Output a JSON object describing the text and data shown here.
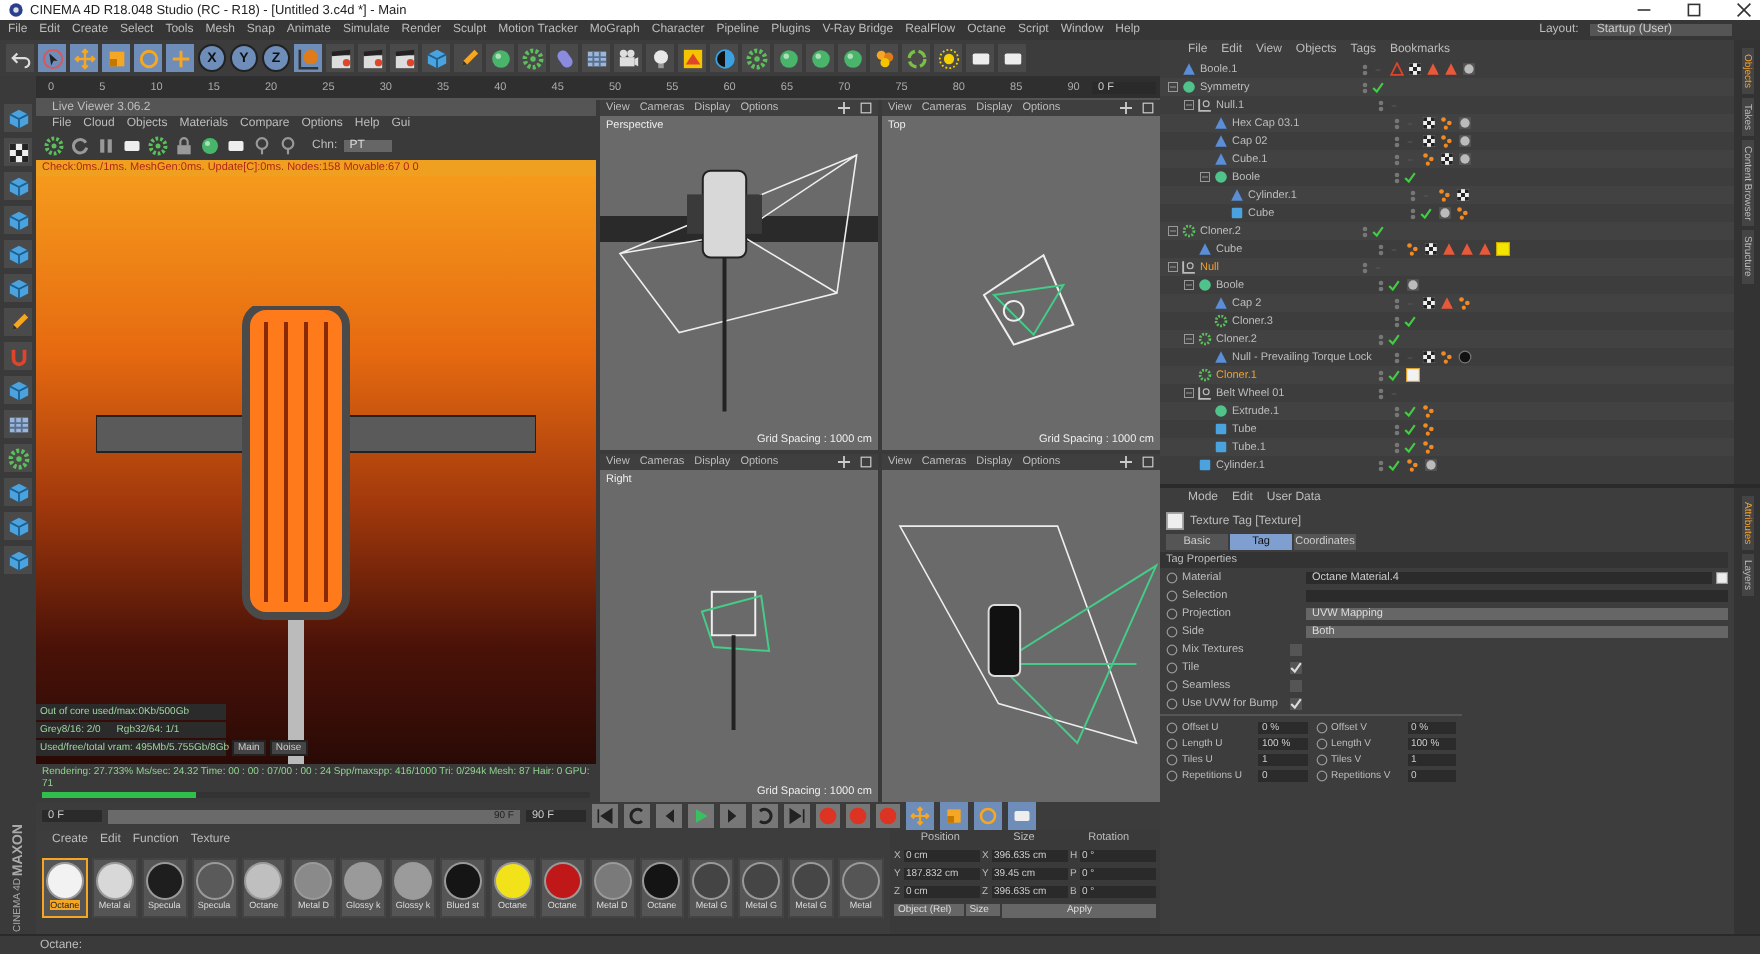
{
  "window": {
    "title": "CINEMA 4D R18.048 Studio (RC - R18) - [Untitled 3.c4d *] - Main"
  },
  "menu_bar": [
    "File",
    "Edit",
    "Create",
    "Select",
    "Tools",
    "Mesh",
    "Snap",
    "Animate",
    "Simulate",
    "Render",
    "Sculpt",
    "Motion Tracker",
    "MoGraph",
    "Character",
    "Pipeline",
    "Plugins",
    "V-Ray Bridge",
    "RealFlow",
    "Octane",
    "Script",
    "Window",
    "Help"
  ],
  "layout": {
    "label": "Layout:",
    "value": "Startup (User)"
  },
  "toolbar": {
    "axis_buttons": [
      "X",
      "Y",
      "Z"
    ]
  },
  "timeline_ruler": {
    "ticks": [
      "0",
      "5",
      "10",
      "15",
      "20",
      "25",
      "30",
      "35",
      "40",
      "45",
      "50",
      "55",
      "60",
      "65",
      "70",
      "75",
      "80",
      "85",
      "90"
    ],
    "frame_field": "0 F"
  },
  "live_viewer": {
    "title": "Live Viewer 3.06.2",
    "menu": [
      "File",
      "Cloud",
      "Objects",
      "Materials",
      "Compare",
      "Options",
      "Help",
      "Gui"
    ],
    "channel_label": "Chn:",
    "channel_value": "PT",
    "status_line": "Check:0ms./1ms. MeshGen:0ms. Update[C]:0ms. Nodes:158 Movable:67  0 0",
    "stats": [
      [
        "Out of core used/max:0Kb/500Gb"
      ],
      [
        "Grey8/16: 2/0",
        "Rgb32/64: 1/1"
      ],
      [
        "Used/free/total vram: 495Mb/5.755Gb/8Gb"
      ]
    ],
    "buttons": [
      "Main",
      "Noise"
    ],
    "render_status": "Rendering: 27.733%  Ms/sec: 24.32  Time: 00 : 00 : 07/00 : 00 : 24  Spp/maxspp: 416/1000  Tri: 0/294k  Mesh: 87  Hair: 0  GPU:  71",
    "level": 0.28
  },
  "viewports": [
    {
      "kind": "perspective",
      "label": "Perspective",
      "menu": [
        "View",
        "Cameras",
        "Display",
        "Options"
      ],
      "grid": "Grid Spacing : 1000 cm"
    },
    {
      "kind": "top",
      "label": "Top",
      "menu": [
        "View",
        "Cameras",
        "Display",
        "Options"
      ],
      "grid": "Grid Spacing : 1000 cm"
    },
    {
      "kind": "right",
      "label": "Right",
      "menu": [
        "View",
        "Cameras",
        "Display",
        "Options"
      ],
      "grid": "Grid Spacing : 1000 cm"
    },
    {
      "kind": "front",
      "menu": [
        "View",
        "Cameras",
        "Display",
        "Options"
      ]
    }
  ],
  "transport": {
    "start_field": "0 F",
    "scrubber_end": "90 F",
    "end_field": "90 F"
  },
  "material_manager": {
    "menu": [
      "Create",
      "Edit",
      "Function",
      "Texture"
    ],
    "materials": [
      {
        "name": "Octane",
        "color": "#f2f2f2",
        "selected": true
      },
      {
        "name": "Metal ai",
        "color": "#d8d8d8",
        "selected": false
      },
      {
        "name": "Specula",
        "color": "#1e1e1e",
        "selected": false
      },
      {
        "name": "Specula",
        "color": "#5a5a5a",
        "selected": false
      },
      {
        "name": "Octane",
        "color": "#bfbfbf",
        "selected": false
      },
      {
        "name": "Metal D",
        "color": "#8a8a8a",
        "selected": false
      },
      {
        "name": "Glossy k",
        "color": "#9a9a9a",
        "selected": false
      },
      {
        "name": "Glossy k",
        "color": "#9b9b9b",
        "selected": false
      },
      {
        "name": "Blued st",
        "color": "#151515",
        "selected": false
      },
      {
        "name": "Octane",
        "color": "#f2e21a",
        "selected": false
      },
      {
        "name": "Octane",
        "color": "#c01818",
        "selected": false
      },
      {
        "name": "Metal D",
        "color": "#7a7a7a",
        "selected": false
      },
      {
        "name": "Octane",
        "color": "#141414",
        "selected": false
      },
      {
        "name": "Metal G",
        "color": "#444444",
        "selected": false
      },
      {
        "name": "Metal G",
        "color": "#454545",
        "selected": false
      },
      {
        "name": "Metal G",
        "color": "#464646",
        "selected": false
      },
      {
        "name": "Metal",
        "color": "#555555",
        "selected": false
      }
    ]
  },
  "coordinates": {
    "headers": [
      "Position",
      "Size",
      "Rotation"
    ],
    "rows": [
      {
        "cells": [
          {
            "axis": "X",
            "value": "0 cm"
          },
          {
            "axis": "X",
            "value": "396.635 cm"
          },
          {
            "axis": "H",
            "value": "0 °"
          }
        ]
      },
      {
        "cells": [
          {
            "axis": "Y",
            "value": "187.832 cm"
          },
          {
            "axis": "Y",
            "value": "39.45 cm"
          },
          {
            "axis": "P",
            "value": "0 °"
          }
        ]
      },
      {
        "cells": [
          {
            "axis": "Z",
            "value": "0 cm"
          },
          {
            "axis": "Z",
            "value": "396.635 cm"
          },
          {
            "axis": "B",
            "value": "0 °"
          }
        ]
      }
    ],
    "mode": "Object (Rel)",
    "size_mode": "Size",
    "apply": "Apply"
  },
  "object_manager": {
    "menu": [
      "File",
      "Edit",
      "View",
      "Objects",
      "Tags",
      "Bookmarks"
    ],
    "items": [
      {
        "name": "Boole.1",
        "kind": "mesh",
        "selected": false,
        "checked": false,
        "tags": [
          {
            "kind": "warning"
          },
          {
            "kind": "checker"
          },
          {
            "kind": "cone"
          },
          {
            "kind": "cone"
          },
          {
            "kind": "material"
          }
        ]
      },
      {
        "name": "Symmetry",
        "kind": "generator",
        "selected": false,
        "checked": true,
        "children": [
          {
            "name": "Null.1",
            "kind": "null",
            "selected": false,
            "checked": false,
            "children": [
              {
                "name": "Hex Cap 03.1",
                "kind": "mesh",
                "selected": false,
                "checked": false,
                "tags": [
                  {
                    "kind": "checker"
                  },
                  {
                    "kind": "dots"
                  },
                  {
                    "kind": "material"
                  }
                ]
              },
              {
                "name": "Cap 02",
                "kind": "mesh",
                "selected": false,
                "checked": false,
                "tags": [
                  {
                    "kind": "checker"
                  },
                  {
                    "kind": "dots"
                  },
                  {
                    "kind": "material"
                  }
                ]
              },
              {
                "name": "Cube.1",
                "kind": "mesh",
                "selected": false,
                "checked": false,
                "tags": [
                  {
                    "kind": "dots"
                  },
                  {
                    "kind": "checker"
                  },
                  {
                    "kind": "material"
                  }
                ]
              },
              {
                "name": "Boole",
                "kind": "generator",
                "selected": false,
                "checked": true,
                "children": [
                  {
                    "name": "Cylinder.1",
                    "kind": "mesh",
                    "selected": false,
                    "checked": false,
                    "tags": [
                      {
                        "kind": "dots"
                      },
                      {
                        "kind": "checker"
                      }
                    ]
                  },
                  {
                    "name": "Cube",
                    "kind": "primitive",
                    "selected": false,
                    "checked": true,
                    "tags": [
                      {
                        "kind": "material"
                      },
                      {
                        "kind": "dots"
                      }
                    ]
                  }
                ]
              }
            ]
          }
        ]
      },
      {
        "name": "Cloner.2",
        "kind": "cloner",
        "selected": false,
        "checked": true,
        "children": [
          {
            "name": "Cube",
            "kind": "mesh",
            "selected": false,
            "checked": false,
            "tags": [
              {
                "kind": "dots"
              },
              {
                "kind": "checker"
              },
              {
                "kind": "cone"
              },
              {
                "kind": "cone"
              },
              {
                "kind": "cone"
              },
              {
                "kind": "yellow"
              }
            ]
          }
        ]
      },
      {
        "name": "Null",
        "kind": "null",
        "selected": true,
        "checked": false,
        "children": [
          {
            "name": "Boole",
            "kind": "generator",
            "selected": false,
            "checked": true,
            "tags": [
              {
                "kind": "material"
              }
            ],
            "children": [
              {
                "name": "Cap 2",
                "kind": "mesh",
                "selected": false,
                "checked": false,
                "tags": [
                  {
                    "kind": "checker"
                  },
                  {
                    "kind": "cone"
                  },
                  {
                    "kind": "dots"
                  }
                ]
              },
              {
                "name": "Cloner.3",
                "kind": "cloner",
                "selected": false,
                "checked": true
              }
            ]
          },
          {
            "name": "Cloner.2",
            "kind": "cloner",
            "selected": false,
            "checked": true,
            "children": [
              {
                "name": "Null - Prevailing Torque Lock",
                "kind": "mesh",
                "selected": false,
                "checked": false,
                "tags": [
                  {
                    "kind": "checker"
                  },
                  {
                    "kind": "dots"
                  },
                  {
                    "kind": "black"
                  }
                ]
              }
            ]
          },
          {
            "name": "Cloner.1",
            "kind": "cloner",
            "selected": true,
            "checked": true,
            "tags": [
              {
                "kind": "white"
              }
            ]
          },
          {
            "name": "Belt Wheel 01",
            "kind": "null",
            "selected": false,
            "checked": false,
            "children": [
              {
                "name": "Extrude.1",
                "kind": "generator",
                "selected": false,
                "checked": true,
                "tags": [
                  {
                    "kind": "dots"
                  }
                ]
              },
              {
                "name": "Tube",
                "kind": "primitive",
                "selected": false,
                "checked": true,
                "tags": [
                  {
                    "kind": "dots"
                  }
                ]
              },
              {
                "name": "Tube.1",
                "kind": "primitive",
                "selected": false,
                "checked": true,
                "tags": [
                  {
                    "kind": "dots"
                  }
                ]
              }
            ]
          },
          {
            "name": "Cylinder.1",
            "kind": "primitive",
            "selected": false,
            "checked": true,
            "tags": [
              {
                "kind": "dots"
              },
              {
                "kind": "material"
              }
            ]
          }
        ]
      }
    ]
  },
  "side_tabs_top": [
    {
      "label": "Objects",
      "selected": true
    },
    {
      "label": "Takes",
      "selected": false
    },
    {
      "label": "Content Browser",
      "selected": false
    },
    {
      "label": "Structure",
      "selected": false
    }
  ],
  "side_tabs_bottom": [
    {
      "label": "Attributes",
      "selected": true
    },
    {
      "label": "Layers",
      "selected": false
    }
  ],
  "attributes": {
    "menu": [
      "Mode",
      "Edit",
      "User Data"
    ],
    "title": "Texture Tag [Texture]",
    "tabs": [
      {
        "label": "Basic",
        "selected": false
      },
      {
        "label": "Tag",
        "selected": true
      },
      {
        "label": "Coordinates",
        "selected": false
      }
    ],
    "section": "Tag Properties",
    "fields": [
      {
        "kind": "link",
        "label": "Material",
        "value": "Octane Material.4"
      },
      {
        "kind": "text",
        "label": "Selection"
      },
      {
        "kind": "dropdown",
        "label": "Projection",
        "value": "UVW Mapping"
      },
      {
        "kind": "dropdown",
        "label": "Side",
        "value": "Both"
      },
      {
        "kind": "checkbox",
        "label": "Mix Textures",
        "checked": false
      },
      {
        "kind": "checkbox",
        "label": "Tile",
        "checked": true
      },
      {
        "kind": "checkbox",
        "label": "Seamless",
        "checked": false
      },
      {
        "kind": "checkbox",
        "label": "Use UVW for Bump",
        "checked": true
      }
    ],
    "numbers": [
      {
        "label": "Offset U",
        "value": "0 %"
      },
      {
        "label": "Offset V",
        "value": "0 %"
      },
      {
        "label": "Length U",
        "value": "100 %"
      },
      {
        "label": "Length V",
        "value": "100 %"
      },
      {
        "label": "Tiles U",
        "value": "1"
      },
      {
        "label": "Tiles V",
        "value": "1"
      },
      {
        "label": "Repetitions U",
        "value": "0"
      },
      {
        "label": "Repetitions V",
        "value": "0"
      }
    ]
  },
  "logo": {
    "brand": "MAXON",
    "product": "CINEMA 4D"
  },
  "status_bar": "Octane:"
}
